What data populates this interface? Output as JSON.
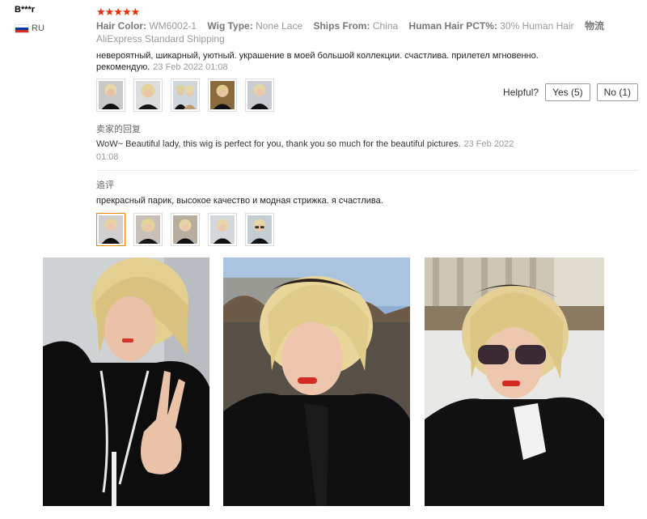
{
  "user": {
    "name": "B***r",
    "country": "RU"
  },
  "review": {
    "rating": 5,
    "star_glyph": "★",
    "attributes": [
      {
        "key": "Hair Color:",
        "value": "WM6002-1"
      },
      {
        "key": "Wig Type:",
        "value": "None Lace"
      },
      {
        "key": "Ships From:",
        "value": "China"
      },
      {
        "key": "Human Hair PCT%:",
        "value": "30% Human Hair"
      },
      {
        "key": "物流",
        "value": "AliExpress Standard Shipping"
      }
    ],
    "text_line1": "невероятный, шикарный, уютный. украшение в моей большой коллекции. счастлива. прилетел мгновенно.",
    "text_line2": "рекомендую.",
    "date": "23 Feb 2022 01:08"
  },
  "helpful": {
    "label": "Helpful?",
    "yes": "Yes (5)",
    "no": "No (1)"
  },
  "seller": {
    "label": "卖家的回复",
    "reply": "WoW~ Beautiful lady, this wig is perfect for you, thank you so much for the beautiful pictures.",
    "date_part1": "23 Feb 2022",
    "date_part2": "01:08"
  },
  "followup": {
    "label": "追评",
    "text": "прекрасный парик, высокое качество и модная стрижка. я счастлива."
  },
  "colors": {
    "star": "#e62e04",
    "active_thumb": "#e88a00"
  }
}
